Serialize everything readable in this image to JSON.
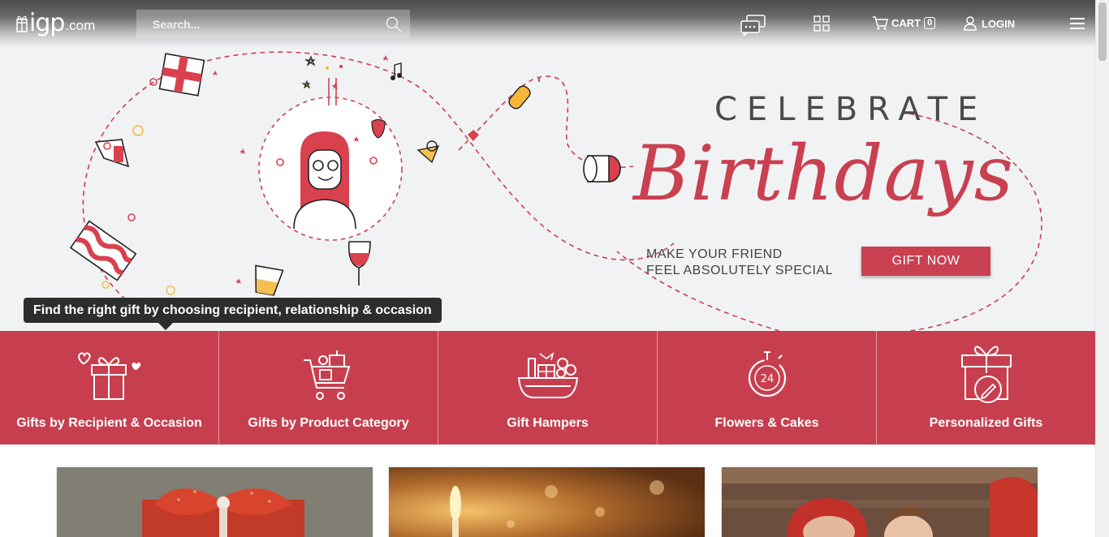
{
  "header": {
    "logo_main": "igp",
    "logo_suffix": ".com",
    "search_placeholder": "Search...",
    "cart_label": "CART",
    "cart_count": "0",
    "login_label": "LOGIN"
  },
  "banner": {
    "celebrate": "CELEBRATE",
    "headline": "Birthdays",
    "tagline_line1": "MAKE YOUR FRIEND",
    "tagline_line2": "FEEL ABSOLUTELY SPECIAL",
    "cta": "GIFT NOW"
  },
  "tooltip": {
    "text": "Find the right gift by choosing recipient, relationship & occasion"
  },
  "categories": [
    {
      "label": "Gifts by Recipient & Occasion",
      "icon": "gift-box-hearts-icon"
    },
    {
      "label": "Gifts by Product Category",
      "icon": "shopping-cart-gifts-icon"
    },
    {
      "label": "Gift Hampers",
      "icon": "hamper-basket-icon"
    },
    {
      "label": "Flowers & Cakes",
      "icon": "24-hour-delivery-icon"
    },
    {
      "label": "Personalized Gifts",
      "icon": "gift-pencil-icon"
    }
  ],
  "icons": {
    "search": "search-icon",
    "chat": "chat-icon",
    "grid": "grid-icon",
    "cart": "cart-icon",
    "user": "user-icon",
    "menu": "hamburger-menu-icon"
  },
  "colors": {
    "brand_red": "#c73f4f",
    "banner_bg": "#f1f2f4",
    "tooltip_bg": "#2d2d2d"
  }
}
